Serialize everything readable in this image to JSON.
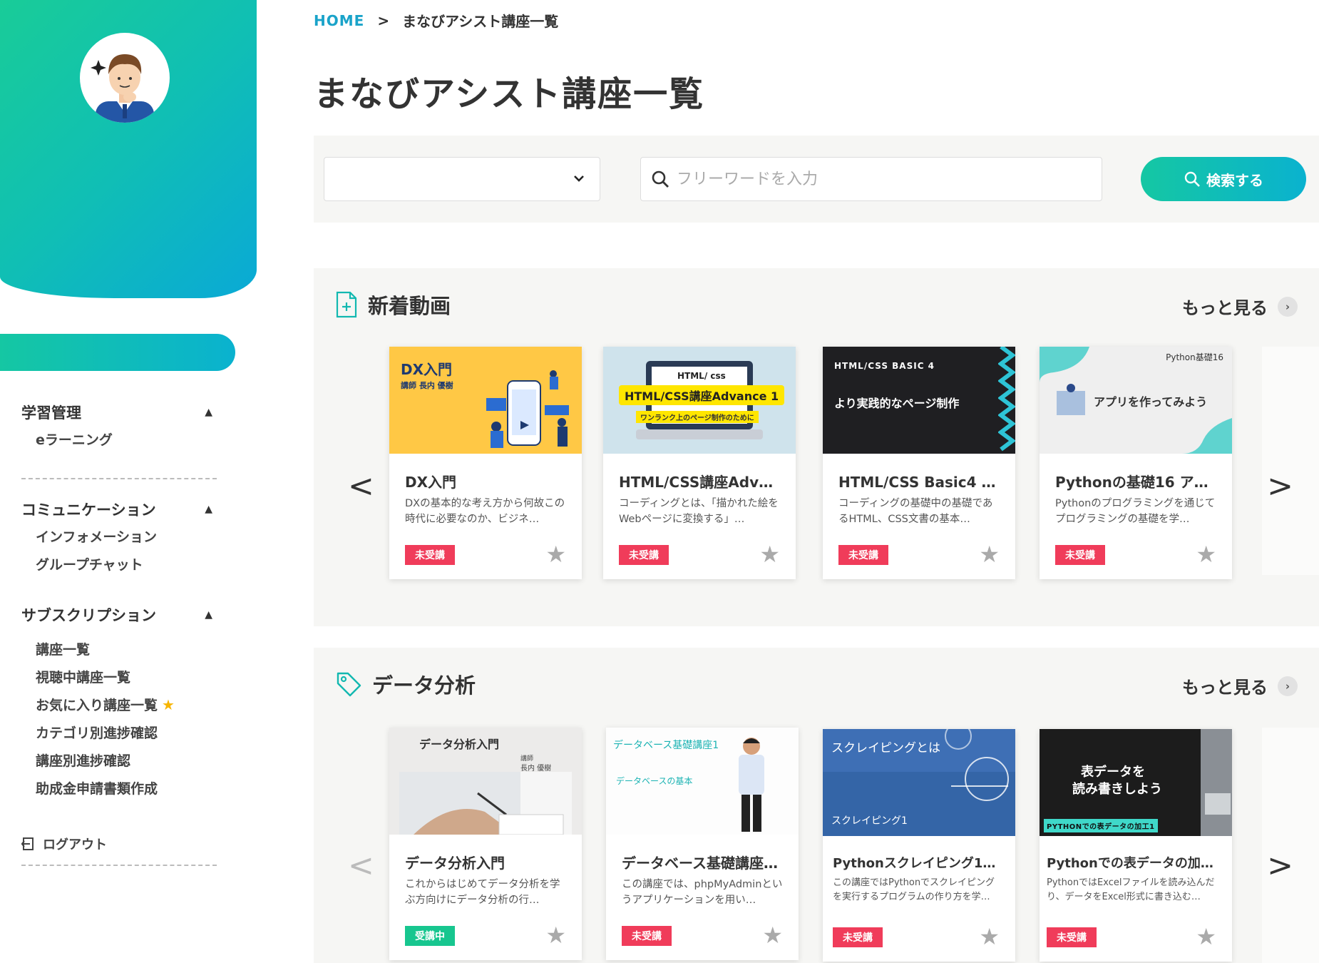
{
  "sidebar": {
    "groups": [
      {
        "title": "学習管理",
        "items": [
          "eラーニング"
        ]
      },
      {
        "title": "コミュニケーション",
        "items": [
          "インフォメーション",
          "グループチャット"
        ]
      },
      {
        "title": "サブスクリプション",
        "items": [
          "講座一覧",
          "視聴中講座一覧",
          "お気に入り講座一覧",
          "カテゴリ別進捗確認",
          "講座別進捗確認",
          "助成金申請書類作成"
        ]
      }
    ],
    "collapse_glyph": "▲",
    "logout": "ログアウト"
  },
  "breadcrumb": {
    "home": "HOME",
    "sep": ">",
    "current": "まなびアシスト講座一覧"
  },
  "page_title": "まなびアシスト講座一覧",
  "search": {
    "placeholder": "フリーワードを入力",
    "button": "検索する",
    "select_value": ""
  },
  "more_label": "もっと見る",
  "arrows": {
    "prev": "<",
    "next": ">"
  },
  "sections": [
    {
      "title": "新着動画",
      "cards": [
        {
          "title": "DX入門",
          "desc": "DXの基本的な考え方から何故この時代に必要なのか、ビジネ…",
          "badge": "未受講",
          "thumb": {
            "line1": "DX入門",
            "line2": "講師 長内 優樹"
          }
        },
        {
          "title": "HTML/CSS講座Adva…",
          "desc": "コーディングとは、「描かれた絵をWebページに変換する」…",
          "badge": "未受講",
          "thumb": {
            "line1": "HTML/ css",
            "line2": "HTML/CSS講座Advance 1",
            "line3": "ワンランク上のページ制作のために"
          }
        },
        {
          "title": "HTML/CSS Basic4 よ…",
          "desc": "コーディングの基礎中の基礎であるHTML、CSS文書の基本…",
          "badge": "未受講",
          "thumb": {
            "line1": "HTML/CSS BASIC 4",
            "line2": "より実践的なページ制作"
          }
        },
        {
          "title": "Pythonの基礎16 アプ…",
          "desc": "Pythonのプログラミングを通じてプログラミングの基礎を学…",
          "badge": "未受講",
          "thumb": {
            "line1": "Python基礎16",
            "line2": "アプリを作ってみよう"
          }
        }
      ]
    },
    {
      "title": "データ分析",
      "cards": [
        {
          "title": "データ分析入門",
          "desc": "これからはじめてデータ分析を学ぶ方向けにデータ分析の行…",
          "badge": "受講中",
          "thumb": {
            "line1": "データ分析入門",
            "line2": "講師",
            "line3": "長内 優樹"
          }
        },
        {
          "title": "データベース基礎講座…",
          "desc": "この講座では、phpMyAdminというアプリケーションを用い…",
          "badge": "未受講",
          "thumb": {
            "line1": "データベース基礎講座1",
            "line2": "データベースの基本"
          }
        },
        {
          "title": "Pythonスクレイピング1 ス…",
          "desc": "この講座ではPythonでスクレイピングを実行するプログラムの作り方を学…",
          "badge": "未受講",
          "thumb": {
            "line1": "スクレイピングとは",
            "line2": "スクレイピング1"
          }
        },
        {
          "title": "Pythonでの表データの加…",
          "desc": "PythonではExcelファイルを読み込んだり、データをExcel形式に書き込む…",
          "badge": "未受講",
          "thumb": {
            "line1": "表データを",
            "line2": "読み書きしよう",
            "line3": "PYTHONでの表データの加工1"
          }
        }
      ]
    }
  ],
  "colors": {
    "accent": "#15c7a3",
    "accent2": "#0ab2cf",
    "badge_red": "#f03c5a",
    "badge_green": "#17c68f"
  }
}
